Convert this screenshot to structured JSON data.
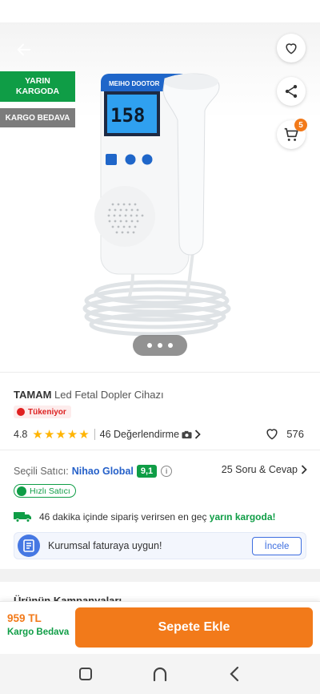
{
  "colors": {
    "brand_orange": "#f27a1a",
    "green": "#0f9d46",
    "seller_blue": "#2560c9",
    "star": "#ffb400"
  },
  "hero": {
    "back_icon": "arrow-left-icon",
    "favorite_icon": "heart-outline-icon",
    "share_icon": "share-icon",
    "cart_icon": "cart-icon",
    "cart_badge": "5",
    "ribbon_delivery_line1": "YARIN",
    "ribbon_delivery_line2": "KARGODA",
    "ribbon_free_shipping": "KARGO BEDAVA",
    "device_screen_value": "158"
  },
  "product": {
    "brand": "TAMAM",
    "name": "Led Fetal Dopler Cihazı",
    "stock_badge": "Tükeniyor",
    "rating": "4.8",
    "stars": 5,
    "reviews": "46 Değerlendirme",
    "favorites": "576"
  },
  "seller": {
    "label": "Seçili Satıcı:",
    "name": "Nihao Global",
    "score": "9,1",
    "qa_link": "25 Soru & Cevap",
    "fast_seller": "Hızlı Satıcı"
  },
  "delivery": {
    "text": "46 dakika içinde sipariş verirsen en geç",
    "highlight": "yarın kargoda!"
  },
  "corporate": {
    "text": "Kurumsal faturaya uygun!",
    "button": "İncele"
  },
  "section_peek": "Ürünün Kampanyaları",
  "buy_bar": {
    "price": "959 TL",
    "free_shipping": "Kargo Bedava",
    "add_to_cart": "Sepete Ekle"
  }
}
